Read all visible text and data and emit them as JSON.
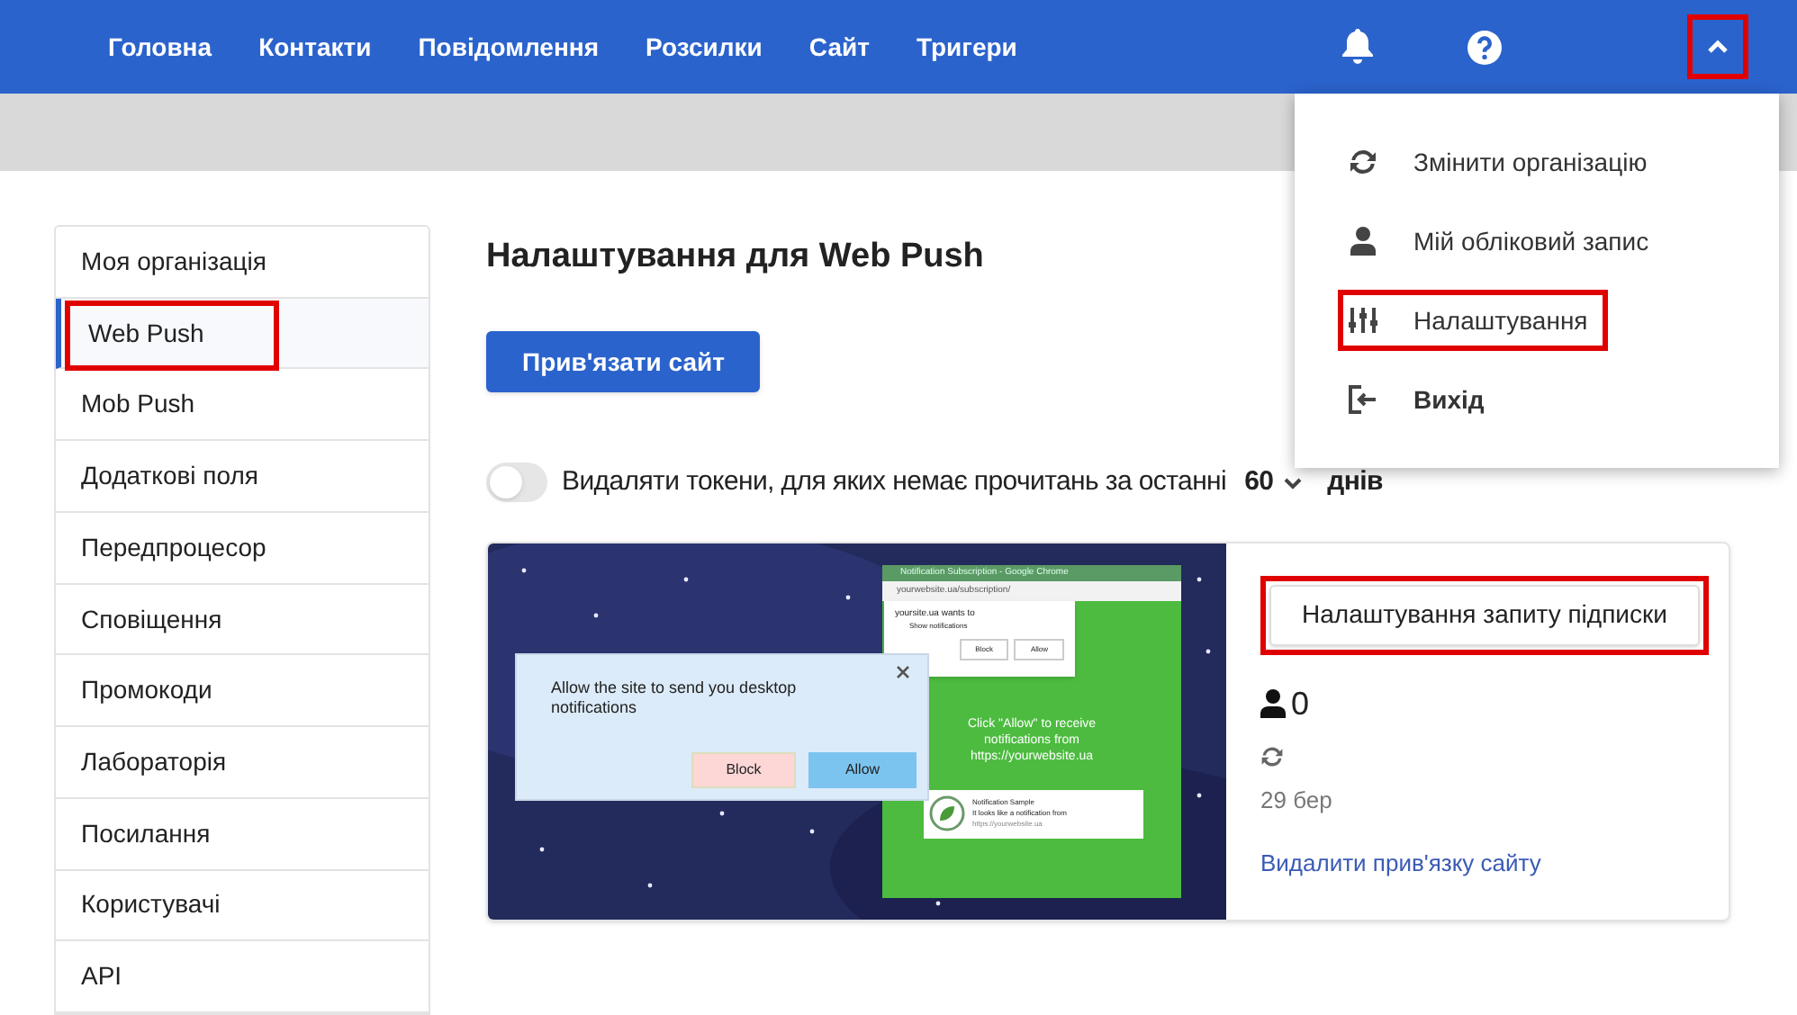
{
  "nav": {
    "items": [
      {
        "label": "Головна"
      },
      {
        "label": "Контакти"
      },
      {
        "label": "Повідомлення"
      },
      {
        "label": "Розсилки"
      },
      {
        "label": "Сайт"
      },
      {
        "label": "Тригери"
      }
    ],
    "account_button": {
      "expanded": true,
      "highlighted": true
    }
  },
  "account_menu": {
    "items": [
      {
        "kind": "sync",
        "label": "Змінити організацію",
        "highlighted": false
      },
      {
        "kind": "user",
        "label": "Мій обліковий запис",
        "highlighted": false
      },
      {
        "kind": "sliders",
        "label": "Налаштування",
        "highlighted": true
      },
      {
        "kind": "exit",
        "label": "Вихід",
        "highlighted": false
      }
    ]
  },
  "sidebar": {
    "items": [
      {
        "label": "Моя організація",
        "selected": false,
        "highlighted": false
      },
      {
        "label": "Web Push",
        "selected": true,
        "highlighted": true
      },
      {
        "label": "Mob Push",
        "selected": false,
        "highlighted": false
      },
      {
        "label": "Додаткові поля",
        "selected": false,
        "highlighted": false
      },
      {
        "label": "Передпроцесор",
        "selected": false,
        "highlighted": false
      },
      {
        "label": "Сповіщення",
        "selected": false,
        "highlighted": false
      },
      {
        "label": "Промокоди",
        "selected": false,
        "highlighted": false
      },
      {
        "label": "Лабораторія",
        "selected": false,
        "highlighted": false
      },
      {
        "label": "Посилання",
        "selected": false,
        "highlighted": false
      },
      {
        "label": "Користувачі",
        "selected": false,
        "highlighted": false
      },
      {
        "label": "API",
        "selected": false,
        "highlighted": false
      }
    ]
  },
  "main": {
    "title": "Налаштування для Web Push",
    "bind_button": "Прив'язати сайт",
    "token_toggle": {
      "on": false,
      "label": "Видаляти токени, для яких немає прочитань за останні",
      "days": "60",
      "suffix": "днів"
    },
    "site_card": {
      "preview": {
        "dialog_text": "Allow the site to send you desktop notifications",
        "dialog_block": "Block",
        "dialog_allow": "Allow",
        "browser_title": "Notification Subscription - Google Chrome",
        "browser_url": "yourwebsite.ua/subscription/",
        "prompt_title": "yoursite.ua wants to",
        "prompt_item": "Show notifications",
        "prompt_block": "Block",
        "prompt_allow": "Allow",
        "green_text": "Click \"Allow\" to receive notifications from https://yourwebsite.ua",
        "sample_title": "Notification Sample",
        "sample_text": "It looks like a notification from",
        "sample_url": "https://yourwebsite.ua"
      },
      "settings_button": {
        "label": "Налаштування запиту підписки",
        "highlighted": true
      },
      "subscribers": "0",
      "date": "29 бер",
      "unlink": "Видалити прив'язку сайту"
    }
  }
}
